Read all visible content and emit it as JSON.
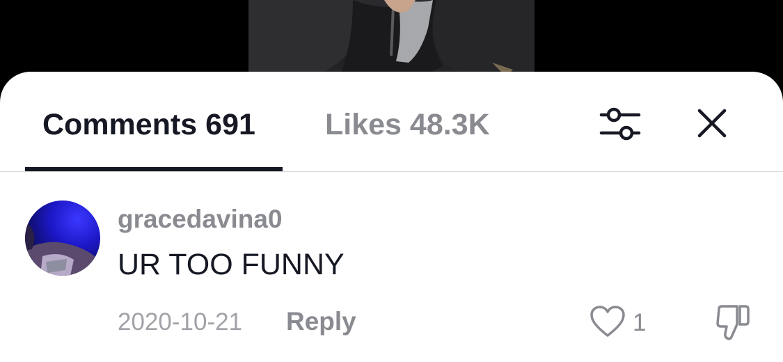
{
  "tabs": {
    "comments_label": "Comments 691",
    "likes_label": "Likes 48.3K"
  },
  "icons": {
    "filter": "filter-sliders-icon",
    "close": "close-icon",
    "like": "heart-outline-icon",
    "dislike": "thumbs-down-icon"
  },
  "comment": {
    "username": "gracedavina0",
    "text": "UR TOO FUNNY",
    "date": "2020-10-21",
    "reply_label": "Reply",
    "like_count": "1"
  },
  "colors": {
    "primary_text": "#161823",
    "secondary_text": "#8a8b91",
    "sheet_background": "#ffffff",
    "video_background": "#000000"
  }
}
